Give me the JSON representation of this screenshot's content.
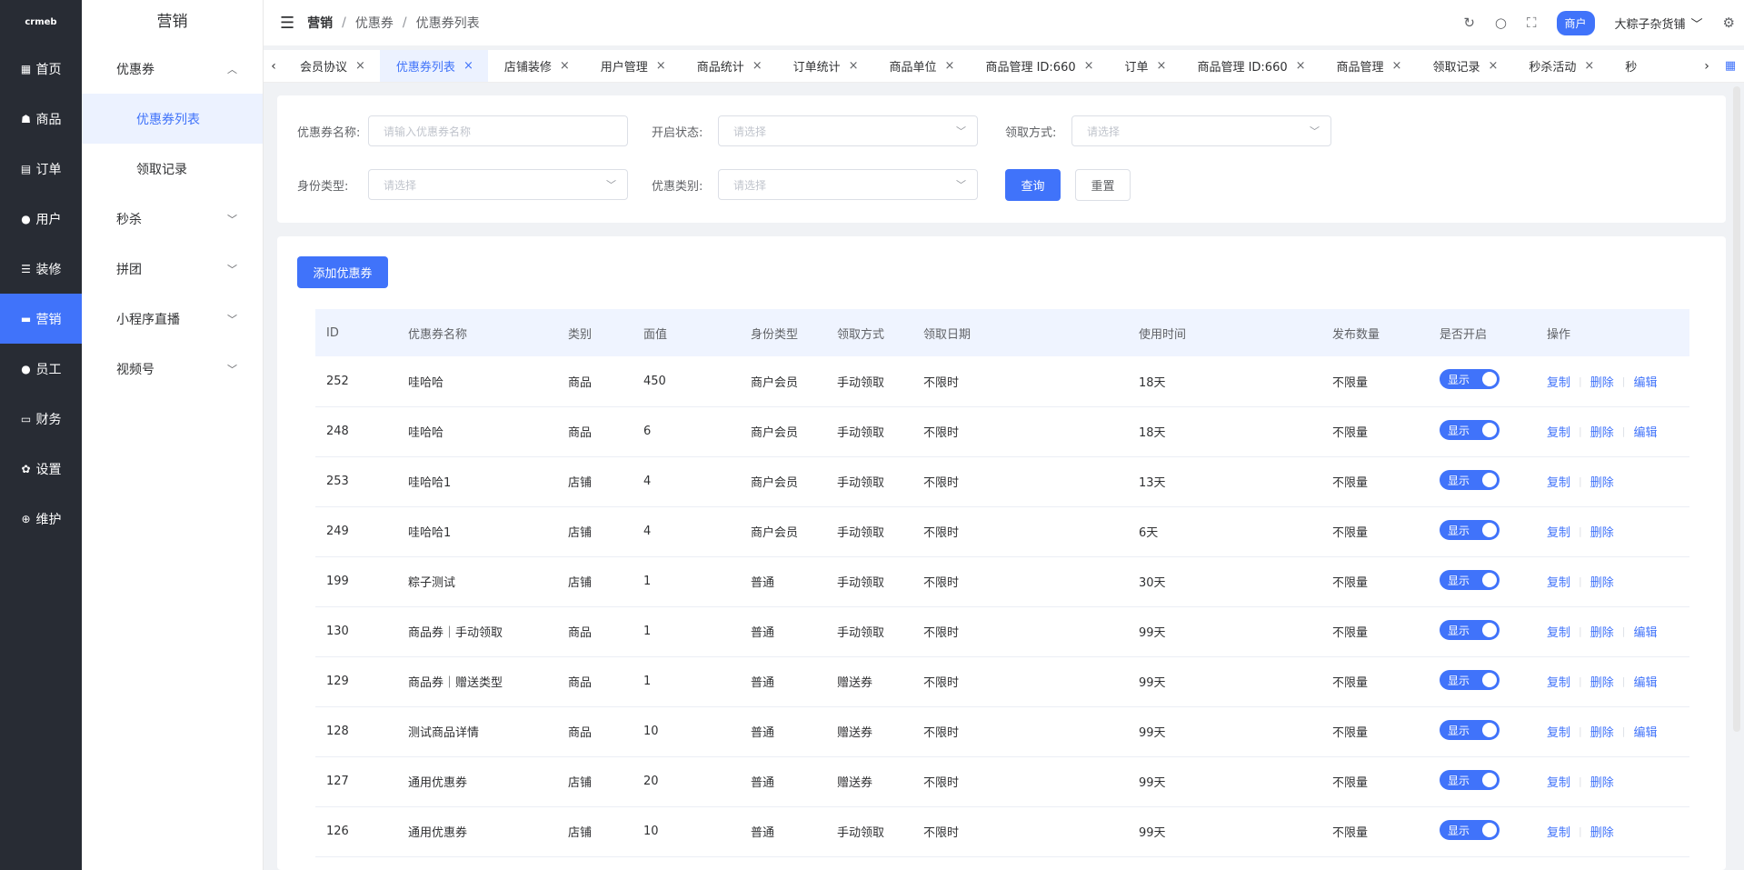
{
  "rail": {
    "logo": "crmeb",
    "items": [
      {
        "icon": "▦",
        "label": "首页"
      },
      {
        "icon": "☗",
        "label": "商品"
      },
      {
        "icon": "▤",
        "label": "订单"
      },
      {
        "icon": "●",
        "label": "用户"
      },
      {
        "icon": "☰",
        "label": "装修"
      },
      {
        "icon": "▬",
        "label": "营销"
      },
      {
        "icon": "●",
        "label": "员工"
      },
      {
        "icon": "▭",
        "label": "财务"
      },
      {
        "icon": "✿",
        "label": "设置"
      },
      {
        "icon": "⊕",
        "label": "维护"
      }
    ]
  },
  "sub": {
    "title": "营销",
    "group_coupon": "优惠券",
    "child_coupon_list": "优惠券列表",
    "child_receive_record": "领取记录",
    "seckill": "秒杀",
    "group_buy": "拼团",
    "live": "小程序直播",
    "video": "视频号"
  },
  "header": {
    "crumb_root": "营销",
    "crumb_mid": "优惠券",
    "crumb_leaf": "优惠券列表",
    "merchant_badge": "商户",
    "user_name": "大粽子杂货铺"
  },
  "tabs": [
    {
      "label": "会员协议"
    },
    {
      "label": "优惠券列表"
    },
    {
      "label": "店铺装修"
    },
    {
      "label": "用户管理"
    },
    {
      "label": "商品统计"
    },
    {
      "label": "订单统计"
    },
    {
      "label": "商品单位"
    },
    {
      "label": "商品管理 ID:660"
    },
    {
      "label": "订单"
    },
    {
      "label": "商品管理 ID:660"
    },
    {
      "label": "商品管理"
    },
    {
      "label": "领取记录"
    },
    {
      "label": "秒杀活动"
    },
    {
      "label": "秒"
    }
  ],
  "filter": {
    "name_label": "优惠券名称:",
    "name_placeholder": "请输入优惠券名称",
    "status_label": "开启状态:",
    "status_placeholder": "请选择",
    "method_label": "领取方式:",
    "method_placeholder": "请选择",
    "identity_label": "身份类型:",
    "identity_placeholder": "请选择",
    "category_label": "优惠类别:",
    "category_placeholder": "请选择",
    "query": "查询",
    "reset": "重置"
  },
  "add_button": "添加优惠券",
  "table": {
    "columns": [
      "ID",
      "优惠券名称",
      "类别",
      "面值",
      "身份类型",
      "领取方式",
      "领取日期",
      "使用时间",
      "发布数量",
      "是否开启",
      "操作"
    ],
    "switch_label": "显示",
    "op_copy": "复制",
    "op_delete": "删除",
    "op_edit": "编辑",
    "rows": [
      {
        "id": "252",
        "name": "哇哈哈",
        "type": "商品",
        "value": "450",
        "identity": "商户会员",
        "method": "手动领取",
        "date": "不限时",
        "use": "18天",
        "count": "不限量"
      },
      {
        "id": "248",
        "name": "哇哈哈",
        "type": "商品",
        "value": "6",
        "identity": "商户会员",
        "method": "手动领取",
        "date": "不限时",
        "use": "18天",
        "count": "不限量"
      },
      {
        "id": "253",
        "name": "哇哈哈1",
        "type": "店铺",
        "value": "4",
        "identity": "商户会员",
        "method": "手动领取",
        "date": "不限时",
        "use": "13天",
        "count": "不限量"
      },
      {
        "id": "249",
        "name": "哇哈哈1",
        "type": "店铺",
        "value": "4",
        "identity": "商户会员",
        "method": "手动领取",
        "date": "不限时",
        "use": "6天",
        "count": "不限量"
      },
      {
        "id": "199",
        "name": "粽子测试",
        "type": "店铺",
        "value": "1",
        "identity": "普通",
        "method": "手动领取",
        "date": "不限时",
        "use": "30天",
        "count": "不限量"
      },
      {
        "id": "130",
        "name": "商品券｜手动领取",
        "type": "商品",
        "value": "1",
        "identity": "普通",
        "method": "手动领取",
        "date": "不限时",
        "use": "99天",
        "count": "不限量"
      },
      {
        "id": "129",
        "name": "商品券｜赠送类型",
        "type": "商品",
        "value": "1",
        "identity": "普通",
        "method": "赠送券",
        "date": "不限时",
        "use": "99天",
        "count": "不限量"
      },
      {
        "id": "128",
        "name": "测试商品详情",
        "type": "商品",
        "value": "10",
        "identity": "普通",
        "method": "赠送券",
        "date": "不限时",
        "use": "99天",
        "count": "不限量"
      },
      {
        "id": "127",
        "name": "通用优惠券",
        "type": "店铺",
        "value": "20",
        "identity": "普通",
        "method": "赠送券",
        "date": "不限时",
        "use": "99天",
        "count": "不限量"
      },
      {
        "id": "126",
        "name": "通用优惠券",
        "type": "店铺",
        "value": "10",
        "identity": "普通",
        "method": "手动领取",
        "date": "不限时",
        "use": "99天",
        "count": "不限量"
      }
    ]
  }
}
